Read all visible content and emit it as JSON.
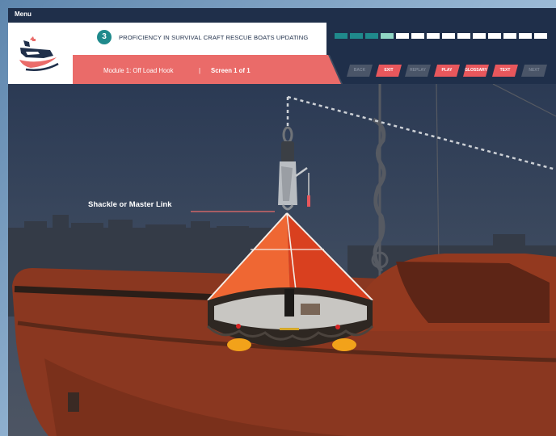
{
  "menu": {
    "label": "Menu"
  },
  "header": {
    "module_number": "3",
    "course_title": "PROFICIENCY IN SURVIVAL CRAFT RESCUE BOATS UPDATING",
    "module_label": "Module 1: Off Load Hook",
    "separator": "|",
    "screen_label": "Screen 1 of 1",
    "progress": {
      "total_segments": 14,
      "visited_segments": 3,
      "current_segment": 4
    }
  },
  "nav": {
    "buttons": [
      {
        "label": "BACK",
        "active": false
      },
      {
        "label": "EXIT",
        "active": true
      },
      {
        "label": "REPLAY",
        "active": false
      },
      {
        "label": "PLAY",
        "active": true
      },
      {
        "label": "GLOSSARY",
        "active": true
      },
      {
        "label": "TEXT",
        "active": true
      },
      {
        "label": "NEXT",
        "active": false
      }
    ]
  },
  "scene": {
    "callout_label": "Shackle or Master Link"
  },
  "colors": {
    "navy": "#1f2f4a",
    "coral": "#ea6b69",
    "teal": "#1f8a8c",
    "raft_orange": "#e9552b",
    "boat_orange": "#c14b24"
  }
}
